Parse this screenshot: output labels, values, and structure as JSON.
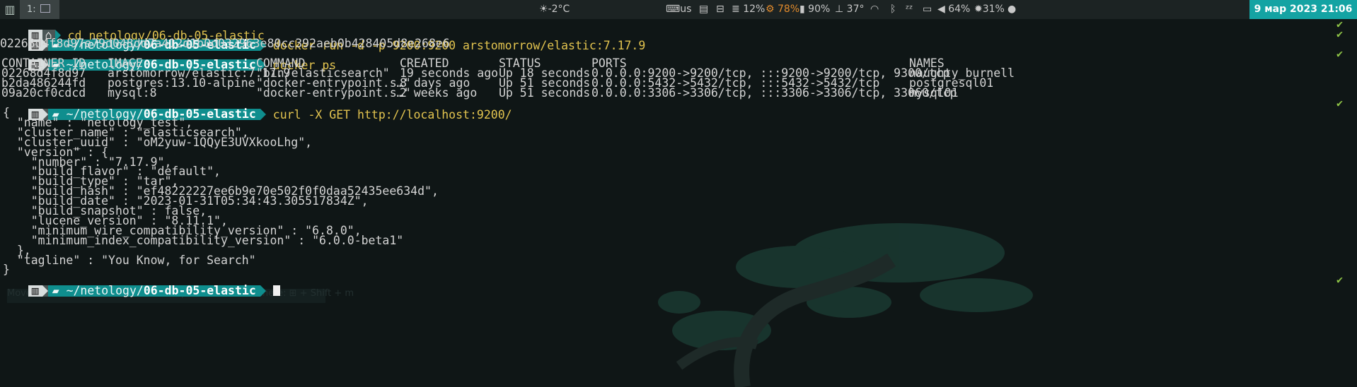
{
  "topbar": {
    "workspace": "1:",
    "weather": "-2°C",
    "keyboard_layout": "us",
    "memory": "12%",
    "battery_left": "78%",
    "battery": "90%",
    "temperature": "37°",
    "volume": "64%",
    "brightness": "31%",
    "datetime": "9 мар 2023 21:06"
  },
  "prompt": {
    "home_symbol": "⌂",
    "path_prefix": "~/netology/",
    "path_bold": "06-db-05-elastic"
  },
  "terminal": {
    "line0_cmd": "cd",
    "line0_arg": "netology/06-db-05-elastic",
    "cmd1": "docker",
    "cmd1_args": "run -d -p 9200:9200 arstomorrow/elastic:7.17.9",
    "container_hash": "02268d4f8d97e79d048dd7a412d1b0d032963e80cc392aeb0b428405d8e268e6",
    "cmd2": "docker",
    "cmd2_args": "ps",
    "cmd3": "curl",
    "cmd3_args": "-X GET http://localhost:9200/",
    "check_mark": "✔"
  },
  "docker_ps": {
    "headers": [
      "CONTAINER ID",
      "IMAGE",
      "COMMAND",
      "CREATED",
      "STATUS",
      "PORTS",
      "NAMES"
    ],
    "rows": [
      [
        "02268d4f8d97",
        "arstomorrow/elastic:7.17.9",
        "\"bin/elasticsearch\"",
        "19 seconds ago",
        "Up 18 seconds",
        "0.0.0.0:9200->9200/tcp, :::9200->9200/tcp, 9300/tcp",
        "naughty_burnell"
      ],
      [
        "b2da486244fd",
        "postgres:13.10-alpine",
        "\"docker-entrypoint.s…\"",
        "8 days ago",
        "Up 51 seconds",
        "0.0.0.0:5432->5432/tcp, :::5432->5432/tcp",
        "postgresql01"
      ],
      [
        "09a20cf0cdcd",
        "mysql:8",
        "\"docker-entrypoint.s…\"",
        "2 weeks ago",
        "Up 51 seconds",
        "0.0.0.0:3306->3306/tcp, :::3306->3306/tcp, 33060/tcp",
        "mysql01"
      ]
    ]
  },
  "json_output": [
    "{",
    "  \"name\" : \"netology_test\",",
    "  \"cluster_name\" : \"elasticsearch\",",
    "  \"cluster_uuid\" : \"oM2yuw-1QQyE3UVXkooLhg\",",
    "  \"version\" : {",
    "    \"number\" : \"7.17.9\",",
    "    \"build_flavor\" : \"default\",",
    "    \"build_type\" : \"tar\",",
    "    \"build_hash\" : \"ef48222227ee6b9e70e502f0f0daa52435ee634d\",",
    "    \"build_date\" : \"2023-01-31T05:34:43.305517834Z\",",
    "    \"build_snapshot\" : false,",
    "    \"lucene_version\" : \"8.11.1\",",
    "    \"minimum_wire_compatibility_version\" : \"6.8.0\",",
    "    \"minimum_index_compatibility_version\" : \"6.0.0-beta1\"",
    "  },",
    "  \"tagline\" : \"You Know, for Search\"",
    "}"
  ],
  "ghost_overlay": {
    "move_window_hint": "Move focused window to a new workspace and switch there:",
    "shortcut": "⊞ + Shift + m"
  },
  "colors": {
    "accent": "#14a3a3",
    "prompt_path_bg": "#0f8e8e",
    "command": "#e3c44f",
    "success": "#8fc547"
  }
}
